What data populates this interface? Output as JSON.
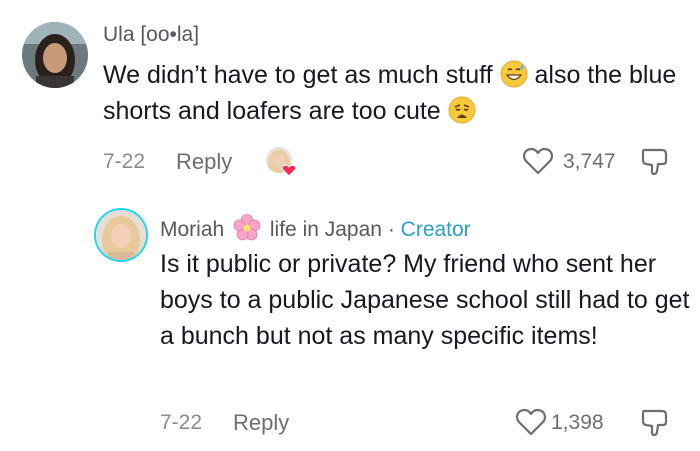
{
  "comment": {
    "username": "Ula [oo•la]",
    "text_part1": "We didn’t have to get as much stuff",
    "text_part2": "also the blue shorts and loafers are too cute",
    "date": "7-22",
    "reply_label": "Reply",
    "likes": "3,747"
  },
  "reply": {
    "username_part1": "Moriah",
    "username_part2": "life in Japan",
    "separator": "·",
    "badge": "Creator",
    "text": "Is it public or private? My friend who sent her boys to a public Japanese school still had to get a bunch but not as many specific items!",
    "date": "7-22",
    "reply_label": "Reply",
    "likes": "1,398"
  },
  "colors": {
    "creator": "#2c9fc7",
    "avatar_ring": "#20d5ec",
    "like_heart_badge": "#fe2c55"
  }
}
